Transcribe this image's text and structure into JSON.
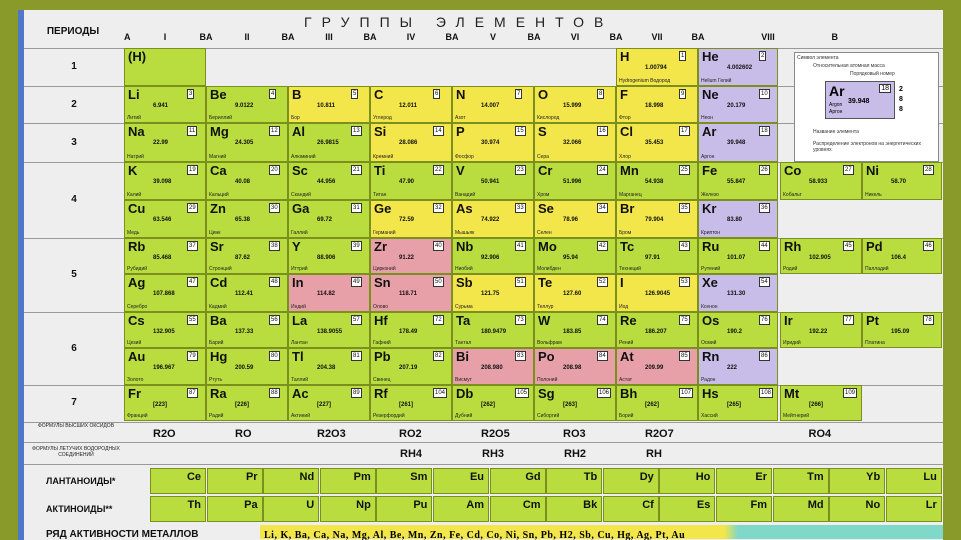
{
  "header": {
    "periods_label": "ПЕРИОДЫ",
    "title": "ГРУППЫ ЭЛЕМЕНТОВ"
  },
  "groups": [
    {
      "a": "A",
      "n": "I",
      "b": "B"
    },
    {
      "a": "A",
      "n": "II",
      "b": "B"
    },
    {
      "a": "A",
      "n": "III",
      "b": "B"
    },
    {
      "a": "A",
      "n": "IV",
      "b": "B"
    },
    {
      "a": "A",
      "n": "V",
      "b": "B"
    },
    {
      "a": "A",
      "n": "VI",
      "b": "B"
    },
    {
      "a": "A",
      "n": "VII",
      "b": "B"
    },
    {
      "a": "A",
      "n": "VIII",
      "b": "B"
    }
  ],
  "periods": [
    "1",
    "2",
    "3",
    "4",
    "5",
    "6",
    "7"
  ],
  "h_cell": "(H)",
  "elements": [
    {
      "s": "H",
      "n": "1",
      "m": "1.00794",
      "name": "Hydrogenium Водород",
      "r": 0,
      "c": "g7",
      "k": "y"
    },
    {
      "s": "He",
      "n": "2",
      "m": "4.002602",
      "name": "Helium Гелий",
      "r": 0,
      "c": "g8",
      "k": "v"
    },
    {
      "s": "Li",
      "n": "3",
      "m": "6.941",
      "name": "Литий",
      "r": 1,
      "c": "g1",
      "k": "g"
    },
    {
      "s": "Be",
      "n": "4",
      "m": "9.0122",
      "name": "Бериллий",
      "r": 1,
      "c": "g2",
      "k": "g"
    },
    {
      "s": "B",
      "n": "5",
      "m": "10.811",
      "name": "Бор",
      "r": 1,
      "c": "g3",
      "k": "y"
    },
    {
      "s": "C",
      "n": "6",
      "m": "12.011",
      "name": "Углерод",
      "r": 1,
      "c": "g4",
      "k": "y"
    },
    {
      "s": "N",
      "n": "7",
      "m": "14.007",
      "name": "Азот",
      "r": 1,
      "c": "g5",
      "k": "y"
    },
    {
      "s": "O",
      "n": "8",
      "m": "15.999",
      "name": "Кислород",
      "r": 1,
      "c": "g6",
      "k": "y"
    },
    {
      "s": "F",
      "n": "9",
      "m": "18.998",
      "name": "Фтор",
      "r": 1,
      "c": "g7",
      "k": "y"
    },
    {
      "s": "Ne",
      "n": "10",
      "m": "20.179",
      "name": "Неон",
      "r": 1,
      "c": "g8",
      "k": "v"
    },
    {
      "s": "Na",
      "n": "11",
      "m": "22.99",
      "name": "Натрий",
      "r": 2,
      "c": "g1",
      "k": "g"
    },
    {
      "s": "Mg",
      "n": "12",
      "m": "24.305",
      "name": "Магний",
      "r": 2,
      "c": "g2",
      "k": "g"
    },
    {
      "s": "Al",
      "n": "13",
      "m": "26.9815",
      "name": "Алюминий",
      "r": 2,
      "c": "g3",
      "k": "g"
    },
    {
      "s": "Si",
      "n": "14",
      "m": "28.086",
      "name": "Кремний",
      "r": 2,
      "c": "g4",
      "k": "y"
    },
    {
      "s": "P",
      "n": "15",
      "m": "30.974",
      "name": "Фосфор",
      "r": 2,
      "c": "g5",
      "k": "y"
    },
    {
      "s": "S",
      "n": "16",
      "m": "32.066",
      "name": "Сера",
      "r": 2,
      "c": "g6",
      "k": "y"
    },
    {
      "s": "Cl",
      "n": "17",
      "m": "35.453",
      "name": "Хлор",
      "r": 2,
      "c": "g7",
      "k": "y"
    },
    {
      "s": "Ar",
      "n": "18",
      "m": "39.948",
      "name": "Аргон",
      "r": 2,
      "c": "g8",
      "k": "v"
    },
    {
      "s": "K",
      "n": "19",
      "m": "39.098",
      "name": "Калий",
      "r": 3,
      "c": "g1",
      "k": "g"
    },
    {
      "s": "Ca",
      "n": "20",
      "m": "40.08",
      "name": "Кальций",
      "r": 3,
      "c": "g2",
      "k": "g"
    },
    {
      "s": "Sc",
      "n": "21",
      "m": "44.956",
      "name": "Скандий",
      "r": 3,
      "c": "g3",
      "k": "g"
    },
    {
      "s": "Ti",
      "n": "22",
      "m": "47.90",
      "name": "Титан",
      "r": 3,
      "c": "g4",
      "k": "g"
    },
    {
      "s": "V",
      "n": "23",
      "m": "50.941",
      "name": "Ванадий",
      "r": 3,
      "c": "g5",
      "k": "g"
    },
    {
      "s": "Cr",
      "n": "24",
      "m": "51.996",
      "name": "Хром",
      "r": 3,
      "c": "g6",
      "k": "g"
    },
    {
      "s": "Mn",
      "n": "25",
      "m": "54.938",
      "name": "Марганец",
      "r": 3,
      "c": "g7",
      "k": "g"
    },
    {
      "s": "Fe",
      "n": "26",
      "m": "55.847",
      "name": "Железо",
      "r": 3,
      "c": "f1",
      "k": "g"
    },
    {
      "s": "Co",
      "n": "27",
      "m": "58.933",
      "name": "Кобальт",
      "r": 3,
      "c": "f2",
      "k": "g"
    },
    {
      "s": "Ni",
      "n": "28",
      "m": "58.70",
      "name": "Никель",
      "r": 3,
      "c": "f3",
      "k": "g"
    },
    {
      "s": "Cu",
      "n": "29",
      "m": "63.546",
      "name": "Медь",
      "r": 4,
      "c": "g1",
      "k": "g"
    },
    {
      "s": "Zn",
      "n": "30",
      "m": "65.38",
      "name": "Цинк",
      "r": 4,
      "c": "g2",
      "k": "g"
    },
    {
      "s": "Ga",
      "n": "31",
      "m": "69.72",
      "name": "Галлий",
      "r": 4,
      "c": "g3",
      "k": "g"
    },
    {
      "s": "Ge",
      "n": "32",
      "m": "72.59",
      "name": "Германий",
      "r": 4,
      "c": "g4",
      "k": "y"
    },
    {
      "s": "As",
      "n": "33",
      "m": "74.922",
      "name": "Мышьяк",
      "r": 4,
      "c": "g5",
      "k": "y"
    },
    {
      "s": "Se",
      "n": "34",
      "m": "78.96",
      "name": "Селен",
      "r": 4,
      "c": "g6",
      "k": "y"
    },
    {
      "s": "Br",
      "n": "35",
      "m": "79.904",
      "name": "Бром",
      "r": 4,
      "c": "g7",
      "k": "y"
    },
    {
      "s": "Kr",
      "n": "36",
      "m": "83.80",
      "name": "Криптон",
      "r": 4,
      "c": "g8",
      "k": "v"
    },
    {
      "s": "Rb",
      "n": "37",
      "m": "85.468",
      "name": "Рубидий",
      "r": 5,
      "c": "g1",
      "k": "g"
    },
    {
      "s": "Sr",
      "n": "38",
      "m": "87.62",
      "name": "Стронций",
      "r": 5,
      "c": "g2",
      "k": "g"
    },
    {
      "s": "Y",
      "n": "39",
      "m": "88.906",
      "name": "Иттрий",
      "r": 5,
      "c": "g3",
      "k": "g"
    },
    {
      "s": "Zr",
      "n": "40",
      "m": "91.22",
      "name": "Цирконий",
      "r": 5,
      "c": "g4",
      "k": "p"
    },
    {
      "s": "Nb",
      "n": "41",
      "m": "92.906",
      "name": "Ниобий",
      "r": 5,
      "c": "g5",
      "k": "g"
    },
    {
      "s": "Mo",
      "n": "42",
      "m": "95.94",
      "name": "Молибден",
      "r": 5,
      "c": "g6",
      "k": "g"
    },
    {
      "s": "Tc",
      "n": "43",
      "m": "97.91",
      "name": "Технеций",
      "r": 5,
      "c": "g7",
      "k": "g"
    },
    {
      "s": "Ru",
      "n": "44",
      "m": "101.07",
      "name": "Рутений",
      "r": 5,
      "c": "f1",
      "k": "g"
    },
    {
      "s": "Rh",
      "n": "45",
      "m": "102.905",
      "name": "Родий",
      "r": 5,
      "c": "f2",
      "k": "g"
    },
    {
      "s": "Pd",
      "n": "46",
      "m": "106.4",
      "name": "Палладий",
      "r": 5,
      "c": "f3",
      "k": "g"
    },
    {
      "s": "Ag",
      "n": "47",
      "m": "107.868",
      "name": "Серебро",
      "r": 6,
      "c": "g1",
      "k": "g"
    },
    {
      "s": "Cd",
      "n": "48",
      "m": "112.41",
      "name": "Кадмий",
      "r": 6,
      "c": "g2",
      "k": "g"
    },
    {
      "s": "In",
      "n": "49",
      "m": "114.82",
      "name": "Индий",
      "r": 6,
      "c": "g3",
      "k": "p"
    },
    {
      "s": "Sn",
      "n": "50",
      "m": "118.71",
      "name": "Олово",
      "r": 6,
      "c": "g4",
      "k": "p"
    },
    {
      "s": "Sb",
      "n": "51",
      "m": "121.75",
      "name": "Сурьма",
      "r": 6,
      "c": "g5",
      "k": "y"
    },
    {
      "s": "Te",
      "n": "52",
      "m": "127.60",
      "name": "Теллур",
      "r": 6,
      "c": "g6",
      "k": "y"
    },
    {
      "s": "I",
      "n": "53",
      "m": "126.9045",
      "name": "Иод",
      "r": 6,
      "c": "g7",
      "k": "y"
    },
    {
      "s": "Xe",
      "n": "54",
      "m": "131.30",
      "name": "Ксенон",
      "r": 6,
      "c": "g8",
      "k": "v"
    },
    {
      "s": "Cs",
      "n": "55",
      "m": "132.905",
      "name": "Цезий",
      "r": 7,
      "c": "g1",
      "k": "g"
    },
    {
      "s": "Ba",
      "n": "56",
      "m": "137.33",
      "name": "Барий",
      "r": 7,
      "c": "g2",
      "k": "g"
    },
    {
      "s": "La",
      "n": "57",
      "m": "138.9055",
      "name": "Лантан",
      "r": 7,
      "c": "g3",
      "k": "g"
    },
    {
      "s": "Hf",
      "n": "72",
      "m": "178.49",
      "name": "Гафний",
      "r": 7,
      "c": "g4",
      "k": "g"
    },
    {
      "s": "Ta",
      "n": "73",
      "m": "180.9479",
      "name": "Тантал",
      "r": 7,
      "c": "g5",
      "k": "g"
    },
    {
      "s": "W",
      "n": "74",
      "m": "183.85",
      "name": "Вольфрам",
      "r": 7,
      "c": "g6",
      "k": "g"
    },
    {
      "s": "Re",
      "n": "75",
      "m": "186.207",
      "name": "Рений",
      "r": 7,
      "c": "g7",
      "k": "g"
    },
    {
      "s": "Os",
      "n": "76",
      "m": "190.2",
      "name": "Осмий",
      "r": 7,
      "c": "f1",
      "k": "g"
    },
    {
      "s": "Ir",
      "n": "77",
      "m": "192.22",
      "name": "Иридий",
      "r": 7,
      "c": "f2",
      "k": "g"
    },
    {
      "s": "Pt",
      "n": "78",
      "m": "195.09",
      "name": "Платина",
      "r": 7,
      "c": "f3",
      "k": "g"
    },
    {
      "s": "Au",
      "n": "79",
      "m": "196.967",
      "name": "Золото",
      "r": 8,
      "c": "g1",
      "k": "g"
    },
    {
      "s": "Hg",
      "n": "80",
      "m": "200.59",
      "name": "Ртуть",
      "r": 8,
      "c": "g2",
      "k": "g"
    },
    {
      "s": "Tl",
      "n": "81",
      "m": "204.38",
      "name": "Таллий",
      "r": 8,
      "c": "g3",
      "k": "g"
    },
    {
      "s": "Pb",
      "n": "82",
      "m": "207.19",
      "name": "Свинец",
      "r": 8,
      "c": "g4",
      "k": "g"
    },
    {
      "s": "Bi",
      "n": "83",
      "m": "208.980",
      "name": "Висмут",
      "r": 8,
      "c": "g5",
      "k": "p"
    },
    {
      "s": "Po",
      "n": "84",
      "m": "208.98",
      "name": "Полоний",
      "r": 8,
      "c": "g6",
      "k": "p"
    },
    {
      "s": "At",
      "n": "85",
      "m": "209.99",
      "name": "Астат",
      "r": 8,
      "c": "g7",
      "k": "p"
    },
    {
      "s": "Rn",
      "n": "86",
      "m": "222",
      "name": "Радон",
      "r": 8,
      "c": "g8",
      "k": "v"
    },
    {
      "s": "Fr",
      "n": "87",
      "m": "[223]",
      "name": "Франций",
      "r": 9,
      "c": "g1",
      "k": "g"
    },
    {
      "s": "Ra",
      "n": "88",
      "m": "[226]",
      "name": "Радий",
      "r": 9,
      "c": "g2",
      "k": "g"
    },
    {
      "s": "Ac",
      "n": "89",
      "m": "[227]",
      "name": "Актиний",
      "r": 9,
      "c": "g3",
      "k": "g"
    },
    {
      "s": "Rf",
      "n": "104",
      "m": "[261]",
      "name": "Резерфордий",
      "r": 9,
      "c": "g4",
      "k": "g"
    },
    {
      "s": "Db",
      "n": "105",
      "m": "[262]",
      "name": "Дубний",
      "r": 9,
      "c": "g5",
      "k": "g"
    },
    {
      "s": "Sg",
      "n": "106",
      "m": "[263]",
      "name": "Сиборгий",
      "r": 9,
      "c": "g6",
      "k": "g"
    },
    {
      "s": "Bh",
      "n": "107",
      "m": "[262]",
      "name": "Борий",
      "r": 9,
      "c": "g7",
      "k": "g"
    },
    {
      "s": "Hs",
      "n": "108",
      "m": "[265]",
      "name": "Хассий",
      "r": 9,
      "c": "f1",
      "k": "g"
    },
    {
      "s": "Mt",
      "n": "109",
      "m": "[266]",
      "name": "Мейтнерий",
      "r": 9,
      "c": "f2",
      "k": "g"
    }
  ],
  "oxides": [
    "R2O",
    "RO",
    "R2O3",
    "RO2",
    "R2O5",
    "RO3",
    "R2O7",
    "RO4"
  ],
  "hydrides": [
    "RH4",
    "RH3",
    "RH2",
    "RH"
  ],
  "oxides_label": "ФОРМУЛЫ ВЫСШИХ ОКСИДОВ",
  "hydrides_label": "ФОРМУЛЫ ЛЕТУЧИХ ВОДОРОДНЫХ СОЕДИНЕНИЙ",
  "lanthanides_label": "ЛАНТАНОИДЫ*",
  "actinides_label": "АКТИНОИДЫ**",
  "lanthanides": [
    "Ce",
    "Pr",
    "Nd",
    "Pm",
    "Sm",
    "Eu",
    "Gd",
    "Tb",
    "Dy",
    "Ho",
    "Er",
    "Tm",
    "Yb",
    "Lu"
  ],
  "actinides": [
    "Th",
    "Pa",
    "U",
    "Np",
    "Pu",
    "Am",
    "Cm",
    "Bk",
    "Cf",
    "Es",
    "Fm",
    "Md",
    "No",
    "Lr"
  ],
  "activity_label": "РЯД АКТИВНОСТИ МЕТАЛЛОВ",
  "activity_series": "Li, K, Ba, Ca, Na, Mg, Al, Be, Mn, Zn, Fe, Cd, Co, Ni, Sn, Pb, H2, Sb, Cu, Hg, Ag, Pt, Au",
  "legend": {
    "symbol_label": "Символ элемента",
    "mass_label": "Относительная атомная масса",
    "number_label": "Порядковый номер",
    "sym": "Ar",
    "num": "18",
    "mass": "39.948",
    "latin": "Argon",
    "ru": "Аргон",
    "name_label": "Название элемента",
    "config_label": "Распределение электронов на энергетических уровнях",
    "shells": "2 8 8"
  },
  "colors": {
    "s": "#b9dd3e",
    "p": "#f2e64a",
    "d": "#b9dd3e",
    "noble": "#c8bce8",
    "border": "#4f79c8",
    "background": "#8a9a2a"
  }
}
